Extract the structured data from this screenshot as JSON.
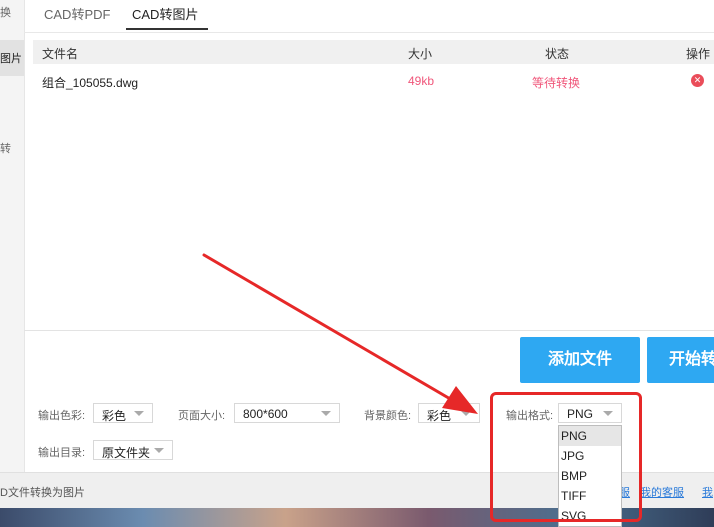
{
  "sidebar": {
    "items": [
      {
        "label": "换"
      },
      {
        "label": "图片"
      },
      {
        "label": "转"
      }
    ]
  },
  "tabs": [
    {
      "label": "CAD转PDF"
    },
    {
      "label": "CAD转图片"
    }
  ],
  "table": {
    "headers": [
      "文件名",
      "大小",
      "状态",
      "操作"
    ],
    "rows": [
      {
        "filename": "组合_105055.dwg",
        "size": "49kb",
        "status": "等待转换",
        "action_icon": "close-circle-icon"
      }
    ]
  },
  "buttons": {
    "add_file": "添加文件",
    "start": "开始转"
  },
  "options": {
    "color_label": "输出色彩:",
    "color_value": "彩色",
    "page_size_label": "页面大小:",
    "page_size_value": "800*600",
    "bg_color_label": "背景颜色:",
    "bg_color_value": "彩色",
    "format_label": "输出格式:",
    "format_value": "PNG",
    "format_options": [
      "PNG",
      "JPG",
      "BMP",
      "TIFF",
      "SVG"
    ],
    "dir_label": "输出目录:",
    "dir_value": "原文件夹"
  },
  "status_bar": {
    "text": "D文件转换为图片",
    "link1": "服",
    "link2": "我的客服",
    "link3": "我"
  },
  "colors": {
    "accent": "#2ea8f2",
    "pink": "#f0567a",
    "annotation_red": "#e62828"
  }
}
